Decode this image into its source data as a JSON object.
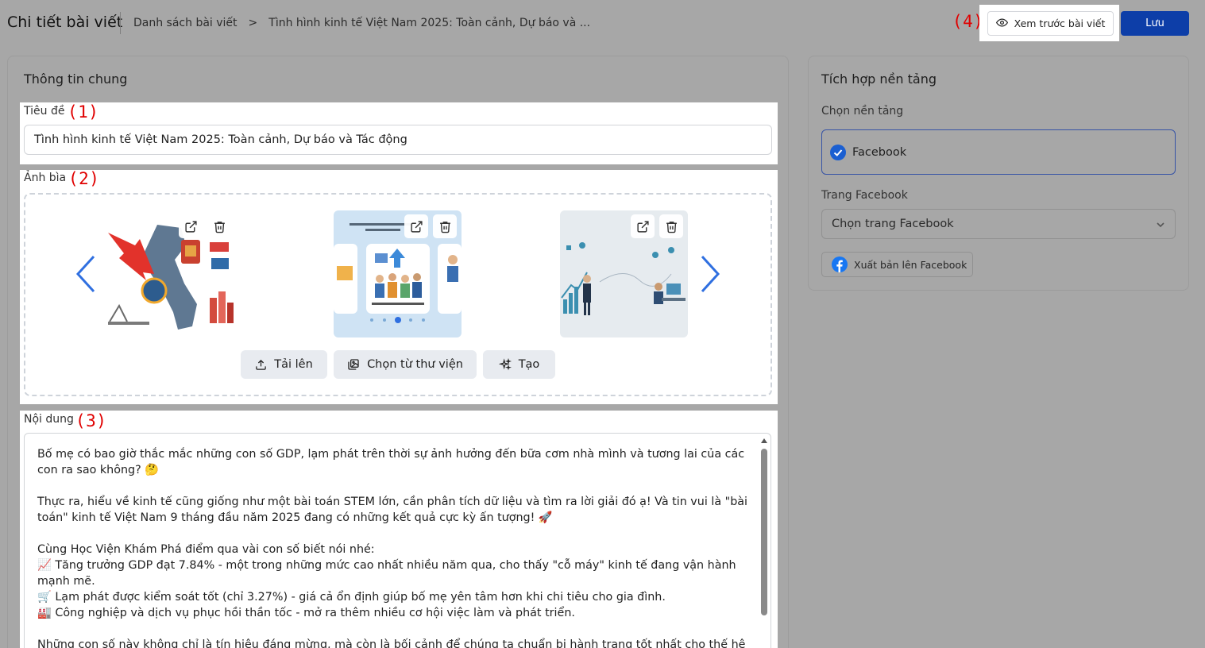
{
  "header": {
    "page_title": "Chi tiết bài viết",
    "breadcrumb": [
      "Danh sách bài viết",
      "Tình hình kinh tế Việt Nam 2025: Toàn cảnh, Dự báo và ..."
    ],
    "breadcrumb_separator": ">",
    "preview_label": "Xem trước bài viết",
    "save_label": "Lưu"
  },
  "annotations": [
    "(1)",
    "(2)",
    "(3)",
    "(4)"
  ],
  "general": {
    "title": "Thông tin chung",
    "title_field": {
      "label": "Tiêu đề",
      "value": "Tình hình kinh tế Việt Nam 2025: Toàn cảnh, Dự báo và Tác động"
    },
    "cover": {
      "label": "Ảnh bìa",
      "images": [
        {
          "name": "vietnam-economy-map"
        },
        {
          "name": "vietnam-industry-infographic"
        },
        {
          "name": "business-growth-illustration"
        }
      ],
      "upload_label": "Tải lên",
      "library_label": "Chọn từ thư viện",
      "generate_label": "Tạo"
    },
    "content": {
      "label": "Nội dung",
      "text": "Bố mẹ có bao giờ thắc mắc những con số GDP, lạm phát trên thời sự ảnh hưởng đến bữa cơm nhà mình và tương lai của các con ra sao không? 🤔\n\nThực ra, hiểu về kinh tế cũng giống như một bài toán STEM lớn, cần phân tích dữ liệu và tìm ra lời giải đó ạ! Và tin vui là \"bài toán\" kinh tế Việt Nam 9 tháng đầu năm 2025 đang có những kết quả cực kỳ ấn tượng! 🚀\n\nCùng Học Viện Khám Phá điểm qua vài con số biết nói nhé:\n📈 Tăng trưởng GDP đạt 7.84% - một trong những mức cao nhất nhiều năm qua, cho thấy \"cỗ máy\" kinh tế đang vận hành mạnh mẽ.\n🛒 Lạm phát được kiểm soát tốt (chỉ 3.27%) - giá cả ổn định giúp bố mẹ yên tâm hơn khi chi tiêu cho gia đình.\n🏭 Công nghiệp và dịch vụ phục hồi thần tốc - mở ra thêm nhiều cơ hội việc làm và phát triển.\n\nNhững con số này không chỉ là tín hiệu đáng mừng, mà còn là bối cảnh để chúng ta chuẩn bị hành trang tốt nhất cho thế hệ"
    }
  },
  "platform": {
    "title": "Tích hợp nền tảng",
    "choose_label": "Chọn nền tảng",
    "selected_platform": "Facebook",
    "page_label": "Trang Facebook",
    "page_select_value": "Chọn trang Facebook",
    "publish_label": "Xuất bản lên Facebook"
  },
  "colors": {
    "accent": "#0d3ea8",
    "annotation": "#e00000",
    "check": "#1b5fd1",
    "facebook": "#1877f2"
  }
}
